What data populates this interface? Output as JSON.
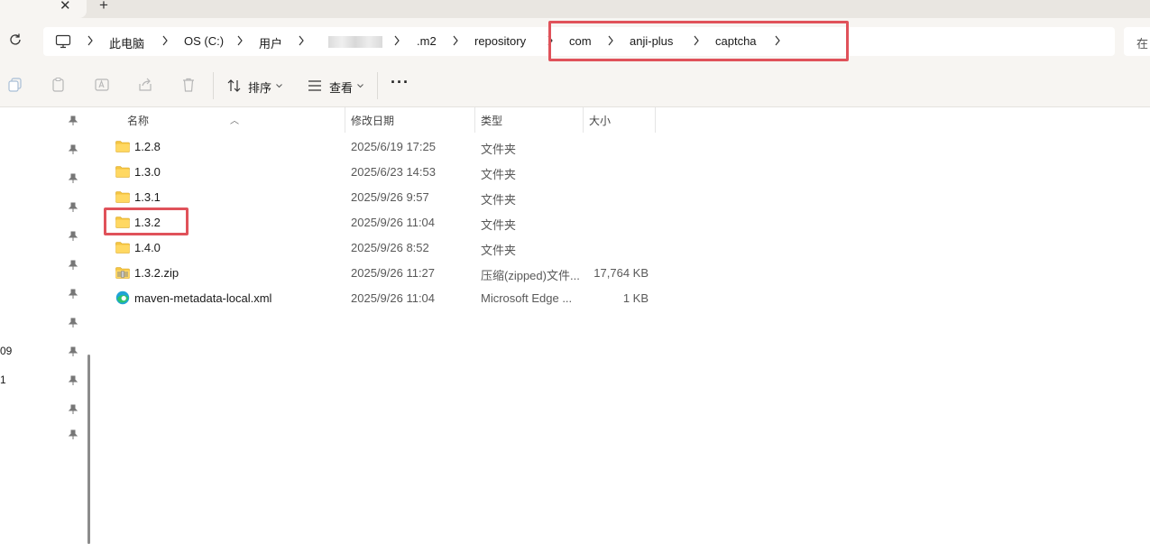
{
  "tab": {
    "close_label": "✕",
    "new_tab_label": "+"
  },
  "address": {
    "crumbs": [
      "此电脑",
      "OS (C:)",
      "用户",
      ".m2",
      "repository",
      "com",
      "anji-plus",
      "captcha"
    ],
    "search_placeholder": "在"
  },
  "toolbar": {
    "sort_label": "排序",
    "view_label": "查看",
    "more_label": "···"
  },
  "navpane": {
    "fragments": [
      "09",
      "1"
    ]
  },
  "columns": {
    "name": "名称",
    "date": "修改日期",
    "type": "类型",
    "size": "大小"
  },
  "files": [
    {
      "name": "1.2.8",
      "date": "2025/6/19 17:25",
      "type": "文件夹",
      "size": "",
      "icon": "folder-icon"
    },
    {
      "name": "1.3.0",
      "date": "2025/6/23 14:53",
      "type": "文件夹",
      "size": "",
      "icon": "folder-icon"
    },
    {
      "name": "1.3.1",
      "date": "2025/9/26 9:57",
      "type": "文件夹",
      "size": "",
      "icon": "folder-icon"
    },
    {
      "name": "1.3.2",
      "date": "2025/9/26 11:04",
      "type": "文件夹",
      "size": "",
      "icon": "folder-icon"
    },
    {
      "name": "1.4.0",
      "date": "2025/9/26 8:52",
      "type": "文件夹",
      "size": "",
      "icon": "folder-icon"
    },
    {
      "name": "1.3.2.zip",
      "date": "2025/9/26 11:27",
      "type": "压缩(zipped)文件...",
      "size": "17,764 KB",
      "icon": "zip-folder-icon"
    },
    {
      "name": "maven-metadata-local.xml",
      "date": "2025/9/26 11:04",
      "type": "Microsoft Edge ...",
      "size": "1 KB",
      "icon": "edge-xml-icon"
    }
  ],
  "colors": {
    "highlight": "#e0525a",
    "folder": "#f4c542",
    "accent": "#0f6cbd"
  }
}
